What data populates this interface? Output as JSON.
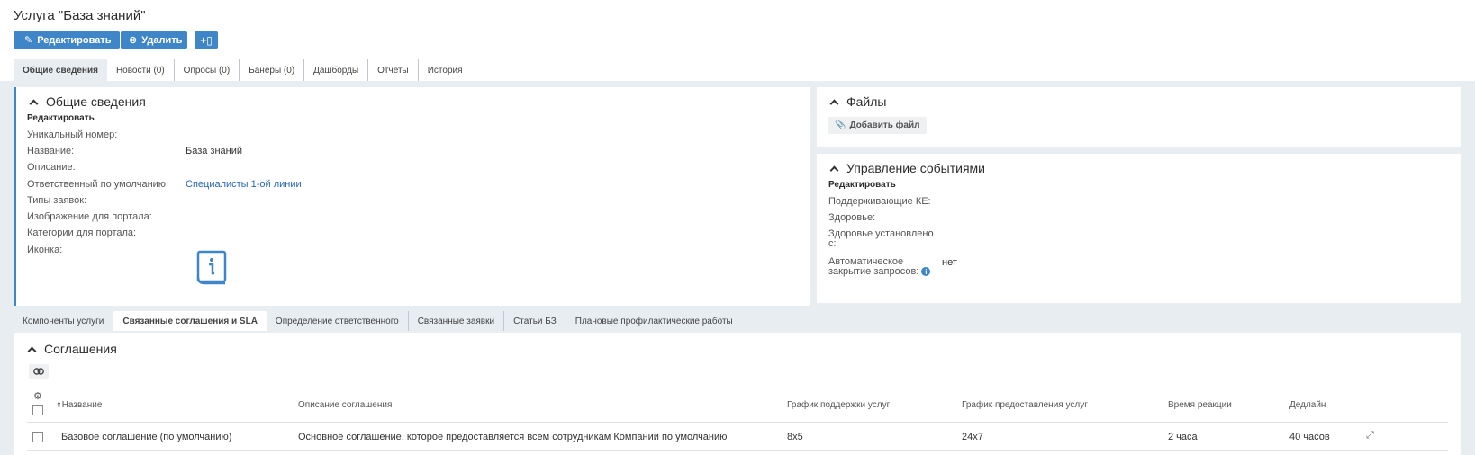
{
  "page": {
    "title": "Услуга \"База знаний\""
  },
  "toolbar": {
    "edit_label": "Редактировать",
    "delete_label": "Удалить"
  },
  "main_tabs": [
    "Общие сведения",
    "Новости (0)",
    "Опросы (0)",
    "Банеры (0)",
    "Дашборды",
    "Отчеты",
    "История"
  ],
  "general": {
    "title": "Общие сведения",
    "edit_link": "Редактировать",
    "fields": [
      {
        "label": "Уникальный номер:",
        "value": ""
      },
      {
        "label": "Название:",
        "value": "База знаний"
      },
      {
        "label": "Описание:",
        "value": ""
      },
      {
        "label": "Ответственный по умолчанию:",
        "value": "Специалисты 1-ой линии"
      },
      {
        "label": "Типы заявок:",
        "value": ""
      },
      {
        "label": "Изображение для портала:",
        "value": ""
      },
      {
        "label": "Категории для портала:",
        "value": ""
      },
      {
        "label": "Иконка:",
        "value": ""
      }
    ],
    "icon": "info-book-icon"
  },
  "files": {
    "title": "Файлы",
    "add_label": "Добавить файл"
  },
  "events": {
    "title": "Управление событиями",
    "edit_link": "Редактировать",
    "fields": [
      {
        "label": "Поддерживающие КЕ:",
        "value": ""
      },
      {
        "label": "Здоровье:",
        "value": ""
      },
      {
        "label_lines": [
          "Здоровье установлено",
          "с:"
        ],
        "value": ""
      },
      {
        "label_lines": [
          "Автоматическое",
          "закрытие запросов:"
        ],
        "value": "нет"
      }
    ]
  },
  "sub_tabs": [
    "Компоненты услуги",
    "Связанные соглашения и SLA",
    "Определение ответственного",
    "Связанные заявки",
    "Статьи БЗ",
    "Плановые профилактические работы"
  ],
  "agreements": {
    "title": "Соглашения",
    "columns": [
      "Название",
      "Описание соглашения",
      "График поддержки услуг",
      "График предоставления услуг",
      "Время реакции",
      "Дедлайн"
    ],
    "rows": [
      [
        "Базовое соглашение (по умолчанию)",
        "Основное соглашение, которое предоставляется всем сотрудникам Компании по умолчанию",
        "8x5",
        "24x7",
        "2 часа",
        "40 часов"
      ]
    ]
  },
  "colors": {
    "accent": "#3f86c8",
    "link": "#2668b3",
    "background": "#e8edf2"
  }
}
